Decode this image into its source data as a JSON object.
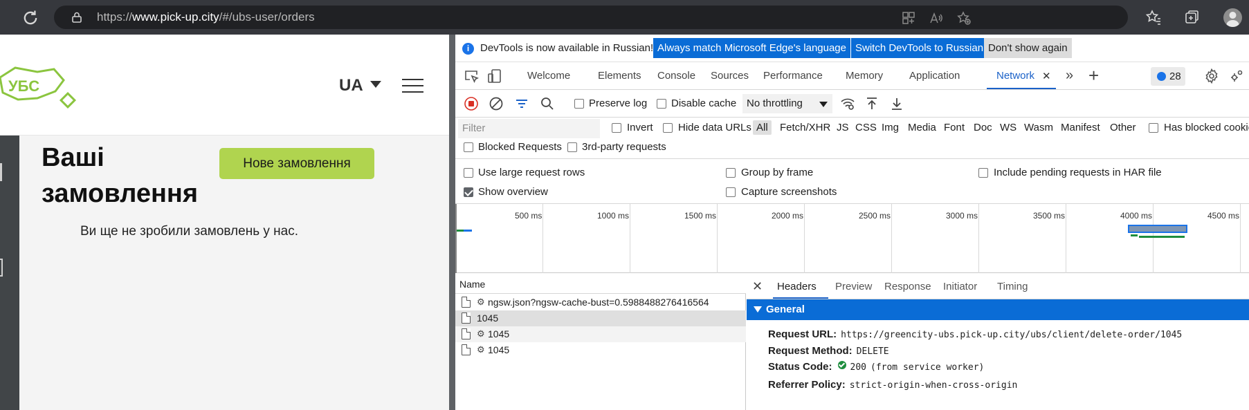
{
  "browser": {
    "url_prefix": "https://",
    "url_domain": "www.pick-up.city",
    "url_path": "/#/ubs-user/orders"
  },
  "site": {
    "logo_text": "УБС",
    "language": "UA",
    "page_title": "Ваші замовлення",
    "new_order_label": "Нове замовлення",
    "empty_message": "Ви ще не зробили замовлень у нас."
  },
  "devtools": {
    "infobar": {
      "message": "DevTools is now available in Russian!",
      "btn_match": "Always match Microsoft Edge's language",
      "btn_switch": "Switch DevTools to Russian",
      "btn_dismiss": "Don't show again"
    },
    "tabs": [
      "Welcome",
      "Elements",
      "Console",
      "Sources",
      "Performance",
      "Memory",
      "Application",
      "Network"
    ],
    "issues_count": "28",
    "toolbar": {
      "preserve_log": "Preserve log",
      "disable_cache": "Disable cache",
      "throttling": "No throttling"
    },
    "filter": {
      "placeholder": "Filter",
      "invert": "Invert",
      "hide_data_urls": "Hide data URLs",
      "types": [
        "All",
        "Fetch/XHR",
        "JS",
        "CSS",
        "Img",
        "Media",
        "Font",
        "Doc",
        "WS",
        "Wasm",
        "Manifest",
        "Other"
      ],
      "has_blocked_cookies": "Has blocked cookies",
      "blocked_requests": "Blocked Requests",
      "third_party": "3rd-party requests"
    },
    "settings": {
      "large_rows": "Use large request rows",
      "group_by_frame": "Group by frame",
      "include_pending": "Include pending requests in HAR file",
      "show_overview": "Show overview",
      "capture_screenshots": "Capture screenshots"
    },
    "overview_ticks": [
      "500 ms",
      "1000 ms",
      "1500 ms",
      "2000 ms",
      "2500 ms",
      "3000 ms",
      "3500 ms",
      "4000 ms",
      "4500 ms"
    ],
    "requests": {
      "header": "Name",
      "rows": [
        {
          "name": "ngsw.json?ngsw-cache-bust=0.5988488276416564",
          "service_worker": true
        },
        {
          "name": "1045",
          "service_worker": false
        },
        {
          "name": "1045",
          "service_worker": true
        },
        {
          "name": "1045",
          "service_worker": true
        }
      ]
    },
    "details": {
      "tabs": [
        "Headers",
        "Preview",
        "Response",
        "Initiator",
        "Timing"
      ],
      "section": "General",
      "request_url_label": "Request URL:",
      "request_url": "https://greencity-ubs.pick-up.city/ubs/client/delete-order/1045",
      "method_label": "Request Method:",
      "method": "DELETE",
      "status_label": "Status Code:",
      "status": "200",
      "status_note": "(from service worker)",
      "referrer_label": "Referrer Policy:",
      "referrer": "strict-origin-when-cross-origin"
    }
  },
  "colors": {
    "accent_blue": "#0a6cd6",
    "button_green": "#b0d44f",
    "logo_green": "#8bc53f"
  }
}
